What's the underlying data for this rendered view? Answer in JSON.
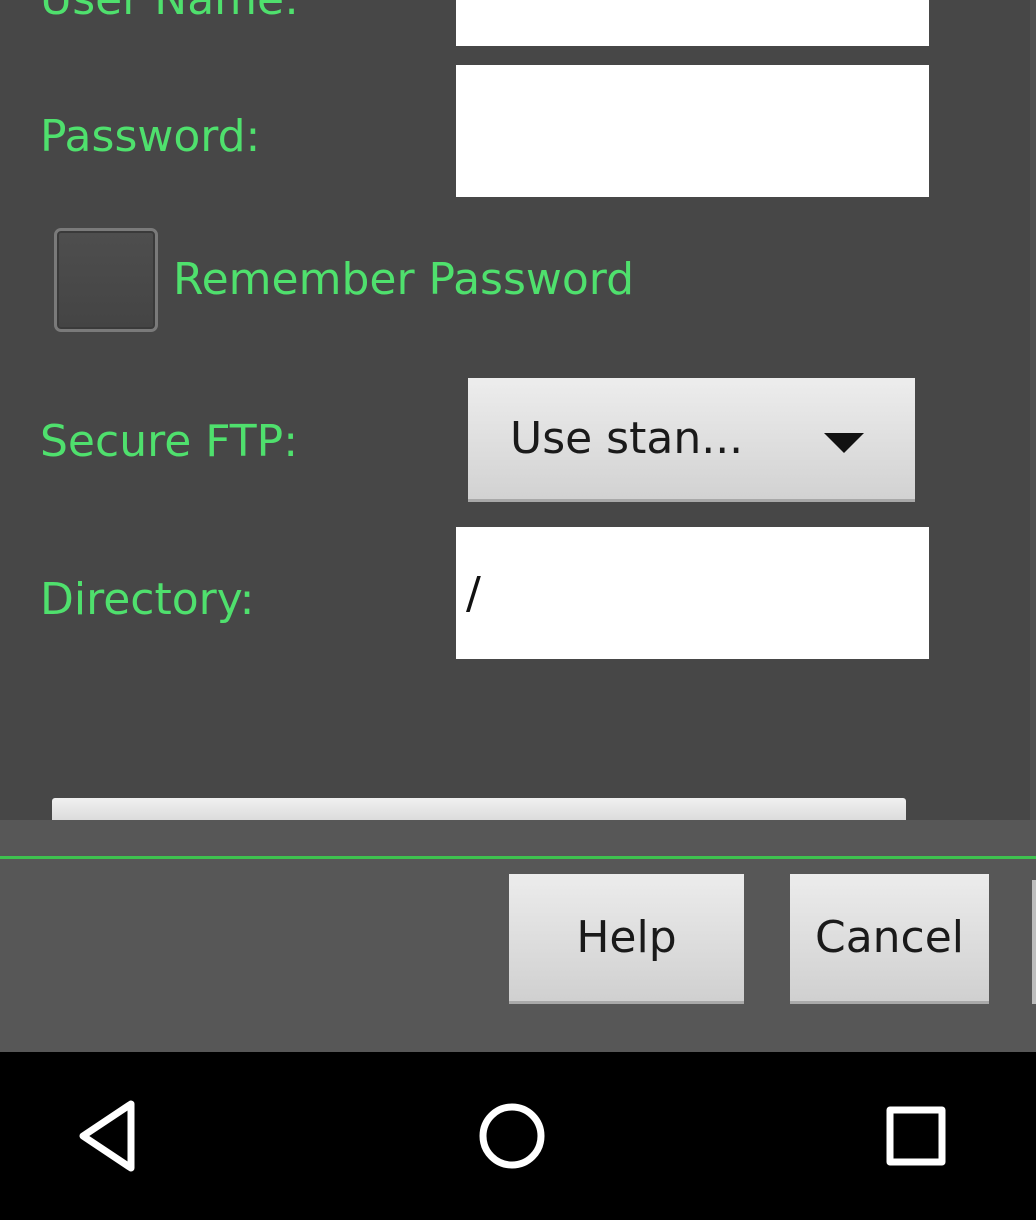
{
  "form": {
    "username_label": "User Name:",
    "password_label": "Password:",
    "password_value": "",
    "remember_password_label": "Remember Password",
    "remember_password_checked": false,
    "secure_ftp_label": "Secure FTP:",
    "secure_ftp_selected": "Use stan...",
    "directory_label": "Directory:",
    "directory_value": "/"
  },
  "buttons": {
    "help": "Help",
    "cancel": "Cancel"
  },
  "nav": {
    "back_icon": "back-triangle-icon",
    "home_icon": "home-circle-icon",
    "recents_icon": "recents-square-icon"
  },
  "colors": {
    "label_green": "#4fe06d",
    "divider_green": "#3ec24f",
    "dialog_background": "#474747",
    "button_bar_background": "#575757"
  }
}
